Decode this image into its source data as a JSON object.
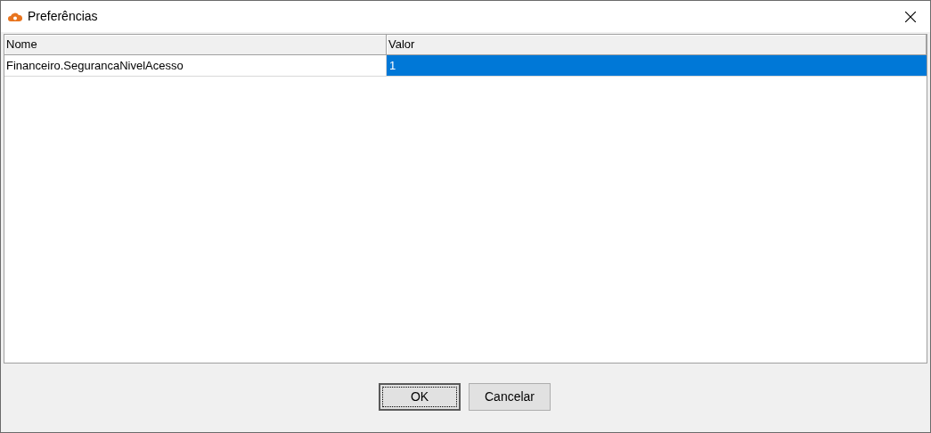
{
  "window": {
    "title": "Preferências"
  },
  "table": {
    "columns": [
      "Nome",
      "Valor"
    ],
    "rows": [
      {
        "name": "Financeiro.SegurancaNivelAcesso",
        "value": "1",
        "selected": true
      }
    ]
  },
  "buttons": [
    {
      "label": "OK",
      "default": true
    },
    {
      "label": "Cancelar",
      "default": false
    }
  ]
}
